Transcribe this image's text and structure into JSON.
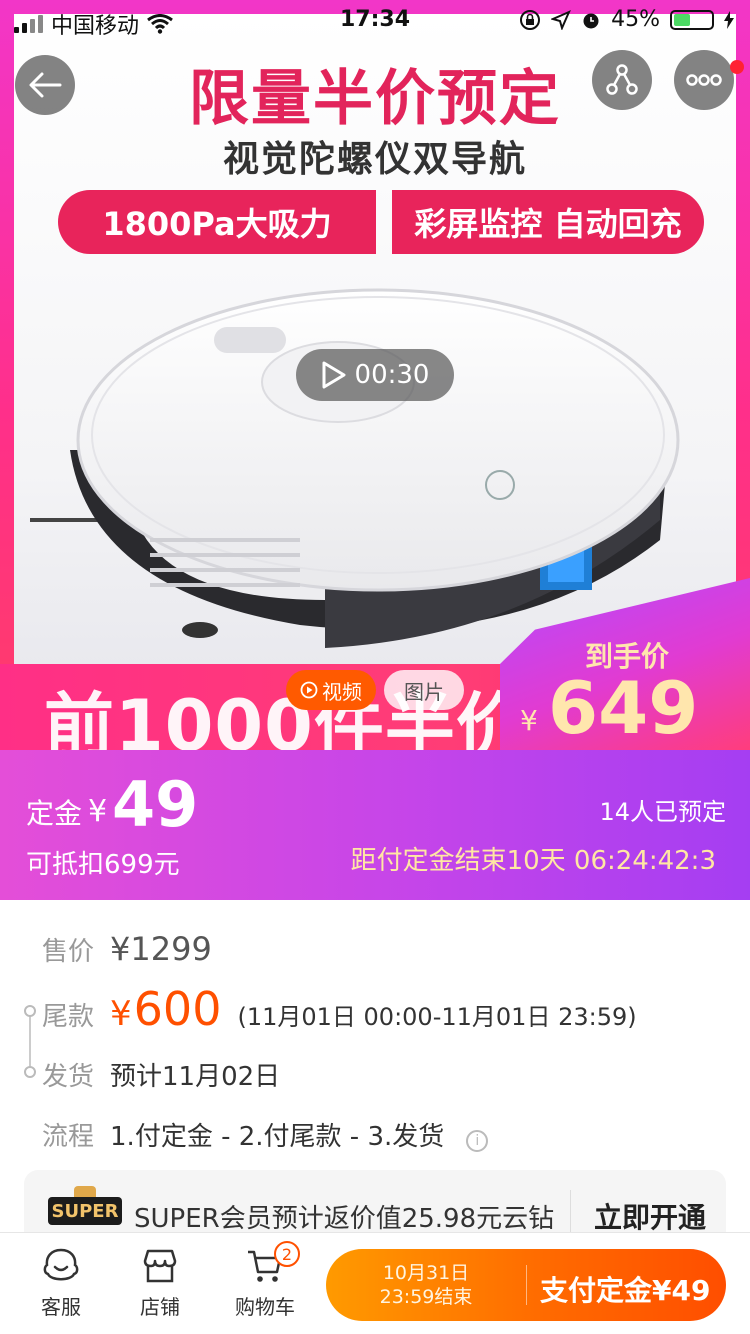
{
  "status_bar": {
    "carrier": "中国移动",
    "time": "17:34",
    "battery": "45%"
  },
  "hero": {
    "headline": "限量半价预定",
    "subline": "视觉陀螺仪双导航",
    "badge_left": "1800Pa大吸力",
    "badge_right": "彩屏监控 自动回充",
    "video_duration": "00:30",
    "banner_text": "前1000件半价",
    "final_price_label": "到手价",
    "final_price_currency": "¥",
    "final_price_value": "649",
    "tab_video": "视频",
    "tab_photo": "图片"
  },
  "deposit": {
    "label": "定金",
    "currency": "¥",
    "value": "49",
    "deduct_note": "可抵扣699元",
    "reserved_count": "14人已预定",
    "countdown": "距付定金结束10天 06:24:42:3"
  },
  "info": {
    "price_label": "售价",
    "price_value": "¥1299",
    "balance_label": "尾款",
    "balance_currency": "¥",
    "balance_value": "600",
    "balance_range": "(11月01日 00:00-11月01日 23:59)",
    "ship_label": "发货",
    "ship_value": "预计11月02日",
    "flow_label": "流程",
    "flow_value": "1.付定金 - 2.付尾款 - 3.发货"
  },
  "super": {
    "badge": "SUPER",
    "text": "SUPER会员预计返价值25.98元云钻",
    "action": "立即开通"
  },
  "bottom_bar": {
    "service": "客服",
    "store": "店铺",
    "cart": "购物车",
    "cart_count": "2",
    "pay_date_line1": "10月31日",
    "pay_date_line2": "23:59结束",
    "pay_label": "支付定金¥49"
  },
  "colors": {
    "accent_pink": "#e8245b",
    "accent_orange": "#ff5000",
    "deposit_purple": "#c545e9"
  }
}
